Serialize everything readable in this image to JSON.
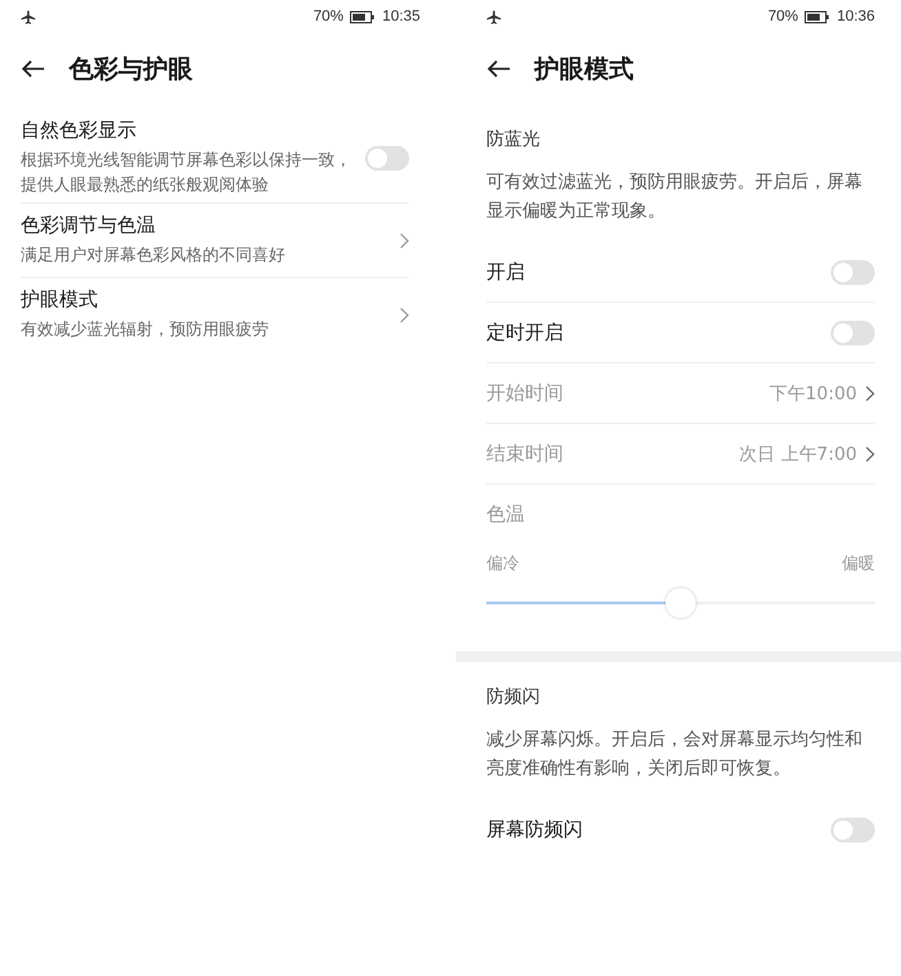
{
  "screens": [
    {
      "status": {
        "battery": "70%",
        "time": "10:35"
      },
      "title": "色彩与护眼",
      "sections": [
        {
          "rows": [
            {
              "kind": "toggle",
              "title": "自然色彩显示",
              "subtitle": "根据环境光线智能调节屏幕色彩以保持一致，提供人眼最熟悉的纸张般观阅体验",
              "on": false,
              "disabled": false
            },
            {
              "kind": "link",
              "title": "色彩调节与色温",
              "subtitle": "满足用户对屏幕色彩风格的不同喜好",
              "disabled": false
            },
            {
              "kind": "link",
              "title": "护眼模式",
              "subtitle": "有效减少蓝光辐射，预防用眼疲劳",
              "disabled": false
            }
          ]
        }
      ]
    },
    {
      "status": {
        "battery": "70%",
        "time": "10:36"
      },
      "title": "护眼模式",
      "sections": [
        {
          "header": "防蓝光",
          "note": "可有效过滤蓝光，预防用眼疲劳。开启后，屏幕显示偏暖为正常现象。",
          "rows": [
            {
              "kind": "toggle",
              "title": "开启",
              "on": false,
              "disabled": false
            },
            {
              "kind": "toggle",
              "title": "定时开启",
              "on": false,
              "disabled": false
            },
            {
              "kind": "link",
              "title": "开始时间",
              "value": "下午10:00",
              "disabled": true
            },
            {
              "kind": "link",
              "title": "结束时间",
              "value": "次日 上午7:00",
              "disabled": true
            },
            {
              "kind": "label",
              "title": "色温",
              "disabled": true
            },
            {
              "kind": "slider",
              "min_label": "偏冷",
              "max_label": "偏暖",
              "level": 0.5,
              "disabled": true
            }
          ]
        },
        {
          "header": "防频闪",
          "note": "减少屏幕闪烁。开启后，会对屏幕显示均匀性和亮度准确性有影响，关闭后即可恢复。",
          "rows": [
            {
              "kind": "toggle",
              "title": "屏幕防频闪",
              "on": false,
              "disabled": false
            }
          ]
        }
      ]
    }
  ]
}
